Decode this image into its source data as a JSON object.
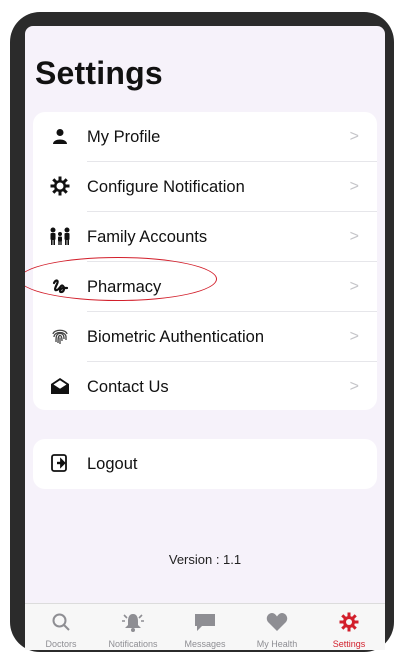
{
  "page": {
    "title": "Settings"
  },
  "menu": {
    "items": [
      {
        "label": "My Profile",
        "icon": "person-icon"
      },
      {
        "label": "Configure Notification",
        "icon": "gear-icon"
      },
      {
        "label": "Family Accounts",
        "icon": "family-icon"
      },
      {
        "label": "Pharmacy",
        "icon": "pharmacy-icon"
      },
      {
        "label": "Biometric Authentication",
        "icon": "fingerprint-icon"
      },
      {
        "label": "Contact Us",
        "icon": "envelope-open-icon"
      }
    ],
    "chevron": ">"
  },
  "logout": {
    "label": "Logout",
    "icon": "logout-icon"
  },
  "version": "Version : 1.1",
  "tabbar": {
    "tabs": [
      {
        "label": "Doctors",
        "icon": "search-icon"
      },
      {
        "label": "Notifications",
        "icon": "bell-icon"
      },
      {
        "label": "Messages",
        "icon": "message-icon"
      },
      {
        "label": "My Health",
        "icon": "heart-icon"
      },
      {
        "label": "Settings",
        "icon": "gear-icon"
      }
    ],
    "active": "Settings"
  },
  "colors": {
    "accent": "#d21f2b",
    "background": "#f6f2fa",
    "inactive": "#8e8e93"
  }
}
